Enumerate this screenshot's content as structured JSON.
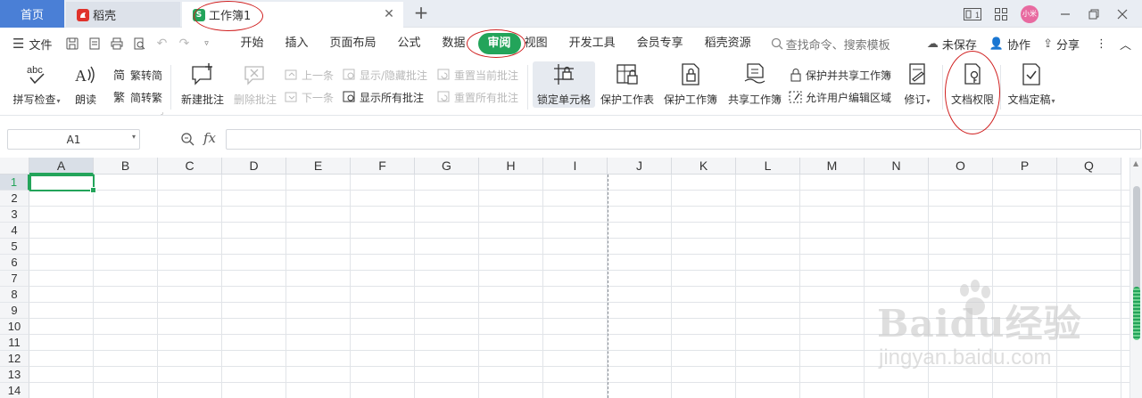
{
  "titlebar": {
    "home_tab": "首页",
    "tabs": [
      {
        "label": "稻壳",
        "icon": "daoke-logo-icon"
      },
      {
        "label": "工作簿1",
        "icon": "spreadsheet-doc-icon"
      }
    ],
    "right_icons": [
      "window-layout-icon",
      "apps-grid-icon",
      "avatar",
      "minimize-icon",
      "restore-icon",
      "close-icon"
    ],
    "avatar_text": "小米"
  },
  "menubar": {
    "file_label": "文件",
    "quick_access": [
      "save-icon",
      "export-pdf-icon",
      "print-icon",
      "print-preview-icon",
      "undo-icon",
      "redo-icon",
      "customize-icon"
    ],
    "items": [
      "开始",
      "插入",
      "页面布局",
      "公式",
      "数据",
      "审阅",
      "视图",
      "开发工具",
      "会员专享",
      "稻壳资源"
    ],
    "active_item": "审阅",
    "search_placeholder": "查找命令、搜索模板",
    "unsaved_label": "未保存",
    "collaborate_label": "协作",
    "share_label": "分享"
  },
  "ribbon": {
    "spell_check": "拼写检查",
    "read_aloud": "朗读",
    "trad_to_simp": "繁转简",
    "simp_to_trad": "简转繁",
    "new_comment": "新建批注",
    "delete_comment": "删除批注",
    "prev_comment": "上一条",
    "next_comment": "下一条",
    "show_hide_comment": "显示/隐藏批注",
    "show_all_comments": "显示所有批注",
    "reset_current_comment": "重置当前批注",
    "reset_all_comments": "重置所有批注",
    "lock_cells": "锁定单元格",
    "protect_sheet": "保护工作表",
    "protect_workbook": "保护工作簿",
    "share_workbook": "共享工作簿",
    "protect_and_share": "保护并共享工作簿",
    "allow_edit_ranges": "允许用户编辑区域",
    "track_changes": "修订",
    "doc_permissions": "文档权限",
    "doc_finalize": "文档定稿"
  },
  "formulabar": {
    "name_box": "A1",
    "fx_label": "fx",
    "formula_value": ""
  },
  "sheet": {
    "columns": [
      "A",
      "B",
      "C",
      "D",
      "E",
      "F",
      "G",
      "H",
      "I",
      "J",
      "K",
      "L",
      "M",
      "N",
      "O",
      "P",
      "Q"
    ],
    "rows": [
      "1",
      "2",
      "3",
      "4",
      "5",
      "6",
      "7",
      "8",
      "9",
      "10",
      "11",
      "12",
      "13",
      "14"
    ],
    "selected_cell": "A1"
  },
  "colors": {
    "accent_green": "#23a45a",
    "home_tab_blue": "#4a7fd6",
    "annotation_red": "#d02020"
  },
  "watermark": {
    "brand": "Baidu经验",
    "url": "jingyan.baidu.com"
  }
}
